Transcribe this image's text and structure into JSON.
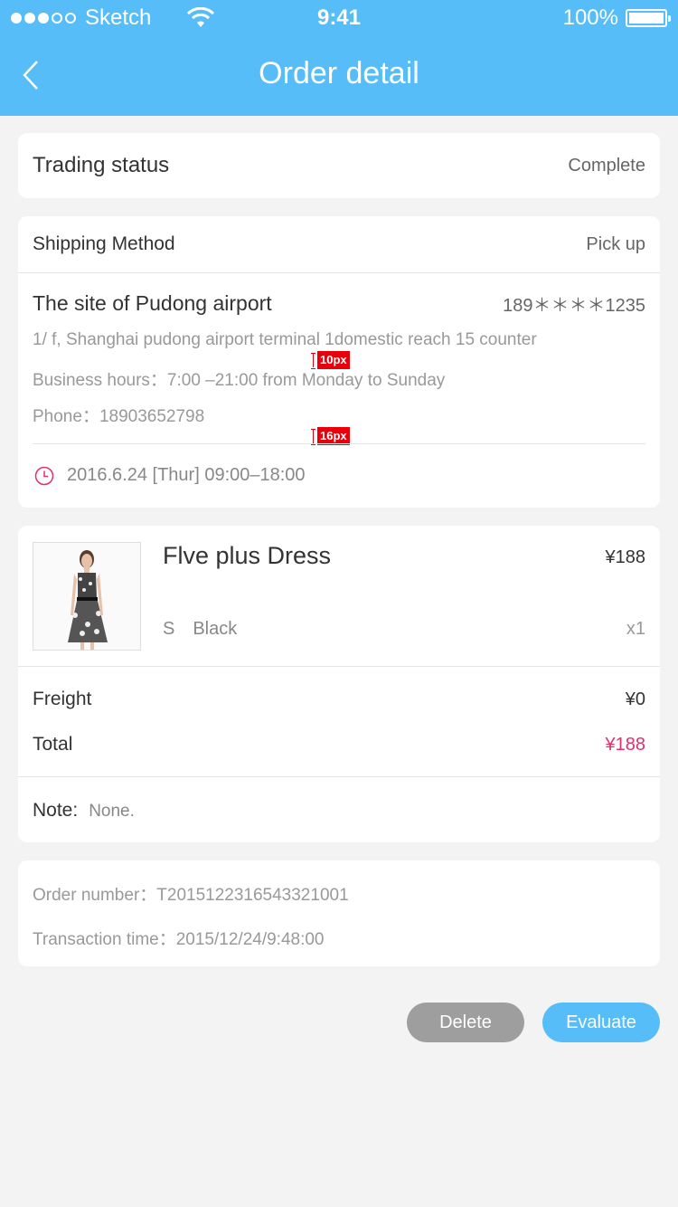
{
  "status_bar": {
    "carrier": "Sketch",
    "time": "9:41",
    "battery": "100%"
  },
  "nav": {
    "title": "Order detail"
  },
  "trading": {
    "label": "Trading status",
    "value": "Complete"
  },
  "shipping": {
    "label": "Shipping Method",
    "value": "Pick up",
    "site_name": "The site of Pudong airport",
    "site_phone_masked": "189＊＊＊＊1235",
    "address": "1/ f, Shanghai pudong airport terminal 1domestic reach 15 counter",
    "hours": "Business hours：7:00 –21:00 from Monday to Sunday",
    "phone": "Phone：18903652798",
    "pickup_time": "2016.6.24 [Thur] 09:00–18:00",
    "spacing_badge_1": "10px",
    "spacing_badge_2": "16px"
  },
  "product": {
    "name": "Flve plus Dress",
    "price": "¥188",
    "size": "S",
    "color": "Black",
    "quantity": "x1",
    "image_icon": "dress-photo"
  },
  "costs": {
    "freight_label": "Freight",
    "freight_value": "¥0",
    "total_label": "Total",
    "total_value": "¥188"
  },
  "note": {
    "label": "Note:",
    "value": "None."
  },
  "order": {
    "number": "Order number：T2015122316543321001",
    "time": "Transaction time：2015/12/24/9:48:00"
  },
  "actions": {
    "delete_label": "Delete",
    "evaluate_label": "Evaluate"
  },
  "colors": {
    "accent": "#56bdf8",
    "total_price": "#e0306e",
    "clock": "#e0306e",
    "delete_button": "#9e9e9e"
  }
}
